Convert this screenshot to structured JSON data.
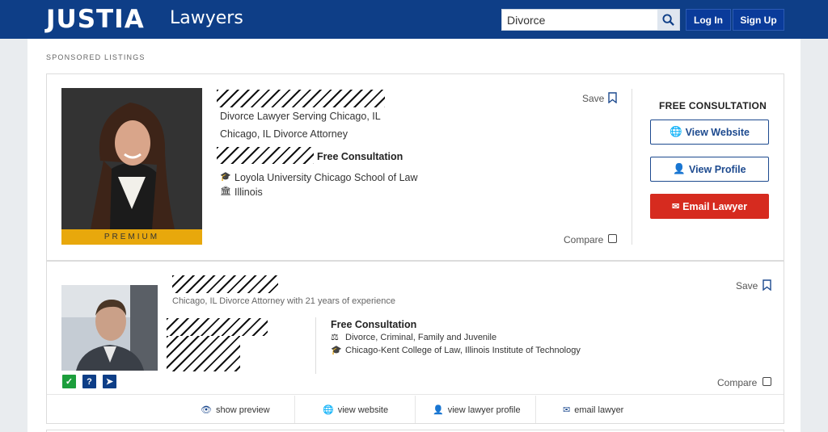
{
  "header": {
    "logo": "JUSTIA",
    "logo_sub": "Lawyers",
    "search_value": "Divorce",
    "login": "Log In",
    "signup": "Sign Up"
  },
  "sponsored_label": "SPONSORED LISTINGS",
  "listing1": {
    "badge": "PREMIUM",
    "tagline": "Divorce Lawyer Serving Chicago, IL",
    "subtitle": "Chicago, IL Divorce Attorney",
    "free_consultation": "Free Consultation",
    "school": "Loyola University Chicago School of Law",
    "state": "Illinois",
    "save": "Save",
    "compare": "Compare",
    "cta_heading": "FREE CONSULTATION",
    "view_website": "View Website",
    "view_profile": "View Profile",
    "email_lawyer": "Email Lawyer"
  },
  "listing2": {
    "subtitle": "Chicago, IL Divorce Attorney with 21 years of experience",
    "free_consultation": "Free Consultation",
    "practice_areas": "Divorce, Criminal, Family and Juvenile",
    "school": "Chicago-Kent College of Law, Illinois Institute of Technology",
    "save": "Save",
    "compare": "Compare",
    "links": {
      "preview": "show preview",
      "website": "view website",
      "profile": "view lawyer profile",
      "email": "email lawyer"
    }
  },
  "icons": {
    "search": "search-icon",
    "bookmark": "bookmark-icon",
    "grad": "graduation-cap-icon",
    "bank": "courthouse-icon",
    "gavel": "gavel-icon",
    "globe": "globe-icon",
    "user": "user-icon",
    "mail": "envelope-icon",
    "eye": "eye-icon",
    "check": "verified-check-icon",
    "question": "question-badge-icon",
    "share": "share-badge-icon"
  },
  "colors": {
    "header_bg": "#0e3e87",
    "premium": "#e8a80c",
    "email_btn": "#d62b1f",
    "verified": "#1c9e3c"
  }
}
